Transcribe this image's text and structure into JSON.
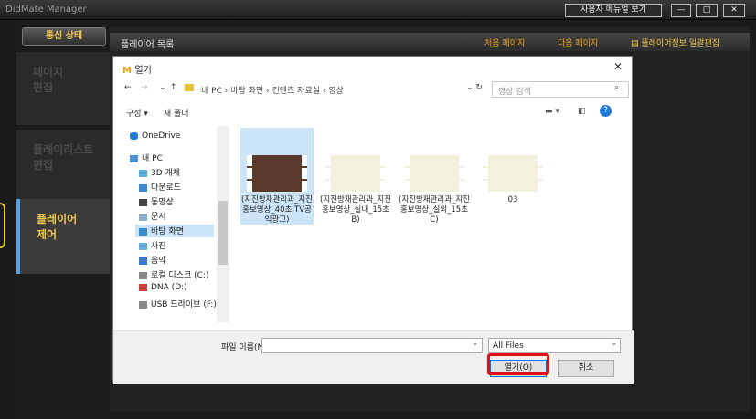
{
  "app": {
    "title": "DidMate Manager",
    "manual_button": "사용자 메뉴얼 보기"
  },
  "sidebar": {
    "status_tab": "통신 상태",
    "items": [
      {
        "label": "페이지\n편집"
      },
      {
        "label": "플레이리스트\n편집"
      },
      {
        "label": "플레이어\n제어"
      }
    ]
  },
  "main": {
    "title": "플레이어 목록",
    "first_page": "처음 페이지",
    "next_page": "다음 페이지",
    "edit_info": "플레이어정보 일괄편집"
  },
  "dialog": {
    "title": "열기",
    "breadcrumb": "내 PC  ›  바탕 화면  ›  컨텐츠 자료실  ›  영상",
    "search_placeholder": "영상 검색",
    "organize": "구성 ▾",
    "new_folder": "새 폴더",
    "tree": [
      "OneDrive",
      "내 PC",
      "3D 개체",
      "다운로드",
      "동영상",
      "문서",
      "바탕 화면",
      "사진",
      "음악",
      "로컬 디스크 (C:)",
      "DNA (D:)",
      "USB 드라이브 (F:)"
    ],
    "files": [
      {
        "name": "(지진방재관리과_지진홍보영상_40초 TV공익광고)"
      },
      {
        "name": "(지진방재관리과_지진홍보영상_실내_15초B)"
      },
      {
        "name": "(지진방재관리과_지진홍보영상_실외_15초C)"
      },
      {
        "name": "03"
      }
    ],
    "filename_label": "파일 이름(N):",
    "filename_value": "",
    "filter": "All Files",
    "open_button": "열기(O)",
    "cancel_button": "취소"
  }
}
